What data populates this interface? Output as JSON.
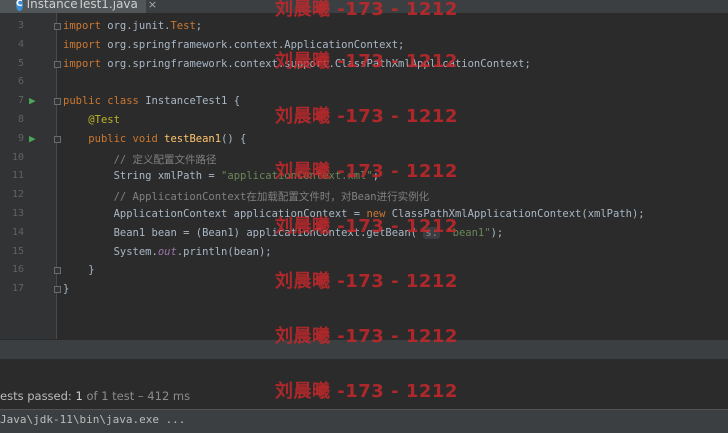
{
  "tab": {
    "icon_letter": "C",
    "label": "InstanceTest1.java",
    "close": "×"
  },
  "colors": {
    "background": "#2b2b2b",
    "keyword": "#cc7832",
    "string": "#6a8759",
    "comment": "#808080",
    "annotation": "#bbb529",
    "method": "#ffc66d",
    "watermark": "#c6282b",
    "run_icon": "#4ea65a"
  },
  "lines": [
    {
      "no": "3",
      "segs": [
        [
          "kw",
          "import "
        ],
        [
          "t",
          "org.junit."
        ],
        [
          "kw",
          "Test"
        ],
        [
          "t",
          ";"
        ]
      ]
    },
    {
      "no": "4",
      "segs": [
        [
          "kw",
          "import "
        ],
        [
          "t",
          "org.springframework.context.ApplicationContext;"
        ]
      ]
    },
    {
      "no": "5",
      "segs": [
        [
          "kw",
          "import "
        ],
        [
          "t",
          "org.springframework.context.support.ClassPathXmlApplicationContext;"
        ]
      ]
    },
    {
      "no": "6",
      "segs": []
    },
    {
      "no": "7",
      "run": true,
      "segs": [
        [
          "kw",
          "public class "
        ],
        [
          "t",
          "InstanceTest1 {"
        ]
      ]
    },
    {
      "no": "8",
      "segs": [
        [
          "t",
          "    "
        ],
        [
          "ann",
          "@Test"
        ]
      ]
    },
    {
      "no": "9",
      "run": true,
      "segs": [
        [
          "t",
          "    "
        ],
        [
          "kw",
          "public void "
        ],
        [
          "fn",
          "testBean1"
        ],
        [
          "t",
          "() {"
        ]
      ]
    },
    {
      "no": "10",
      "segs": [
        [
          "t",
          "        "
        ],
        [
          "cmt",
          "// 定义配置文件路径"
        ]
      ]
    },
    {
      "no": "11",
      "segs": [
        [
          "t",
          "        String xmlPath = "
        ],
        [
          "str",
          "\"applicationContext.xml\""
        ],
        [
          "t",
          ";"
        ]
      ]
    },
    {
      "no": "12",
      "segs": [
        [
          "t",
          "        "
        ],
        [
          "cmt",
          "// ApplicationContext在加载配置文件时，对Bean进行实例化"
        ]
      ]
    },
    {
      "no": "13",
      "segs": [
        [
          "t",
          "        ApplicationContext applicationContext = "
        ],
        [
          "kw",
          "new "
        ],
        [
          "t",
          "ClassPathXmlApplicationContext(xmlPath);"
        ]
      ]
    },
    {
      "no": "14",
      "segs": [
        [
          "t",
          "        Bean1 bean = (Bean1) applicationContext.getBean( "
        ],
        [
          "hint",
          "s:"
        ],
        [
          "t",
          " "
        ],
        [
          "str",
          "\"bean1\""
        ],
        [
          "t",
          ");"
        ]
      ]
    },
    {
      "no": "15",
      "segs": [
        [
          "t",
          "        System."
        ],
        [
          "ital",
          "out"
        ],
        [
          "t",
          ".println(bean);"
        ]
      ]
    },
    {
      "no": "16",
      "segs": [
        [
          "t",
          "    }"
        ]
      ]
    },
    {
      "no": "17",
      "segs": [
        [
          "t",
          "}"
        ]
      ]
    }
  ],
  "run_result": {
    "prefix": "ests passed: ",
    "count": "1",
    "suffix": " of 1 test",
    "duration": " – 412 ms"
  },
  "run_command": "Java\\jdk-11\\bin\\java.exe ...",
  "watermark": "刘晨曦 -173 - 1212"
}
